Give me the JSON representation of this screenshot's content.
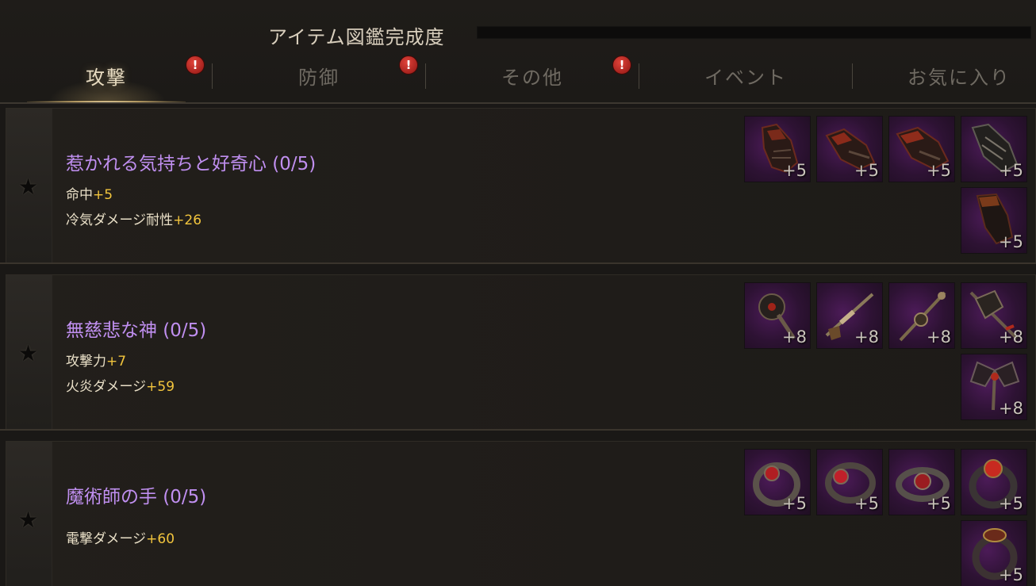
{
  "header": {
    "completion_title": "アイテム図鑑完成度",
    "completion_progress": 0
  },
  "tabs": [
    {
      "label": "攻撃",
      "active": true,
      "alert": true
    },
    {
      "label": "防御",
      "active": false,
      "alert": true
    },
    {
      "label": "その他",
      "active": false,
      "alert": true
    },
    {
      "label": "イベント",
      "active": false,
      "alert": false
    },
    {
      "label": "お気に入り",
      "active": false,
      "alert": false
    }
  ],
  "alert_symbol": "!",
  "star_symbol": "★",
  "sets": [
    {
      "name": "惹かれる気持ちと好奇心 (0/5)",
      "stats": [
        {
          "label": "命中",
          "value": "+5"
        },
        {
          "label": "冷気ダメージ耐性",
          "value": "+26"
        }
      ],
      "item_kind": "gauntlet-icon",
      "items": [
        "+5",
        "+5",
        "+5",
        "+5",
        "+5"
      ]
    },
    {
      "name": "無慈悲な神 (0/5)",
      "stats": [
        {
          "label": "攻撃力",
          "value": "+7"
        },
        {
          "label": "火炎ダメージ",
          "value": "+59"
        }
      ],
      "item_kind": "weapon-icon",
      "items": [
        "+8",
        "+8",
        "+8",
        "+8",
        "+8"
      ]
    },
    {
      "name": "魔術師の手 (0/5)",
      "stats": [
        {
          "label": "電撃ダメージ",
          "value": "+60"
        }
      ],
      "item_kind": "ring-icon",
      "items": [
        "+5",
        "+5",
        "+5",
        "+5",
        "+5"
      ]
    }
  ],
  "colors": {
    "set_name": "#c08ff0",
    "stat_value": "#f2c53d",
    "alert": "#c4231b"
  }
}
